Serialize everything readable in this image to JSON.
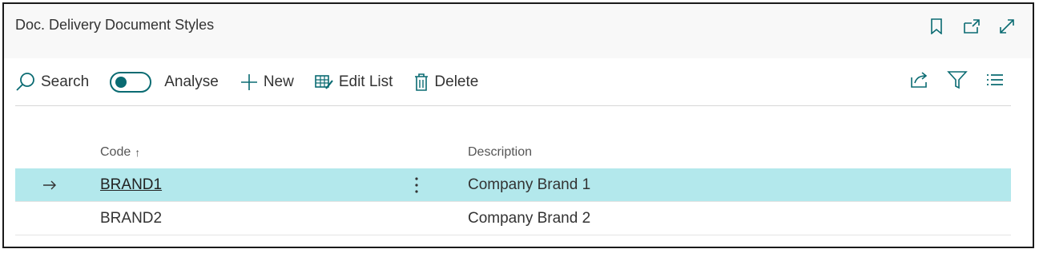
{
  "page": {
    "title": "Doc. Delivery Document Styles"
  },
  "header_actions": [
    {
      "name": "bookmark-icon"
    },
    {
      "name": "open-new-window-icon"
    },
    {
      "name": "expand-icon"
    }
  ],
  "actionbar": {
    "search_label": "Search",
    "analyse_label": "Analyse",
    "analyse_on": true,
    "new_label": "New",
    "edit_list_label": "Edit List",
    "delete_label": "Delete"
  },
  "table": {
    "columns": {
      "code": "Code",
      "code_sort": "↑",
      "description": "Description"
    },
    "rows": [
      {
        "code": "BRAND1",
        "description": "Company Brand 1",
        "selected": true
      },
      {
        "code": "BRAND2",
        "description": "Company Brand 2",
        "selected": false
      }
    ]
  },
  "colors": {
    "accent": "#0a6b72",
    "selected_row": "#b3e8ec"
  }
}
